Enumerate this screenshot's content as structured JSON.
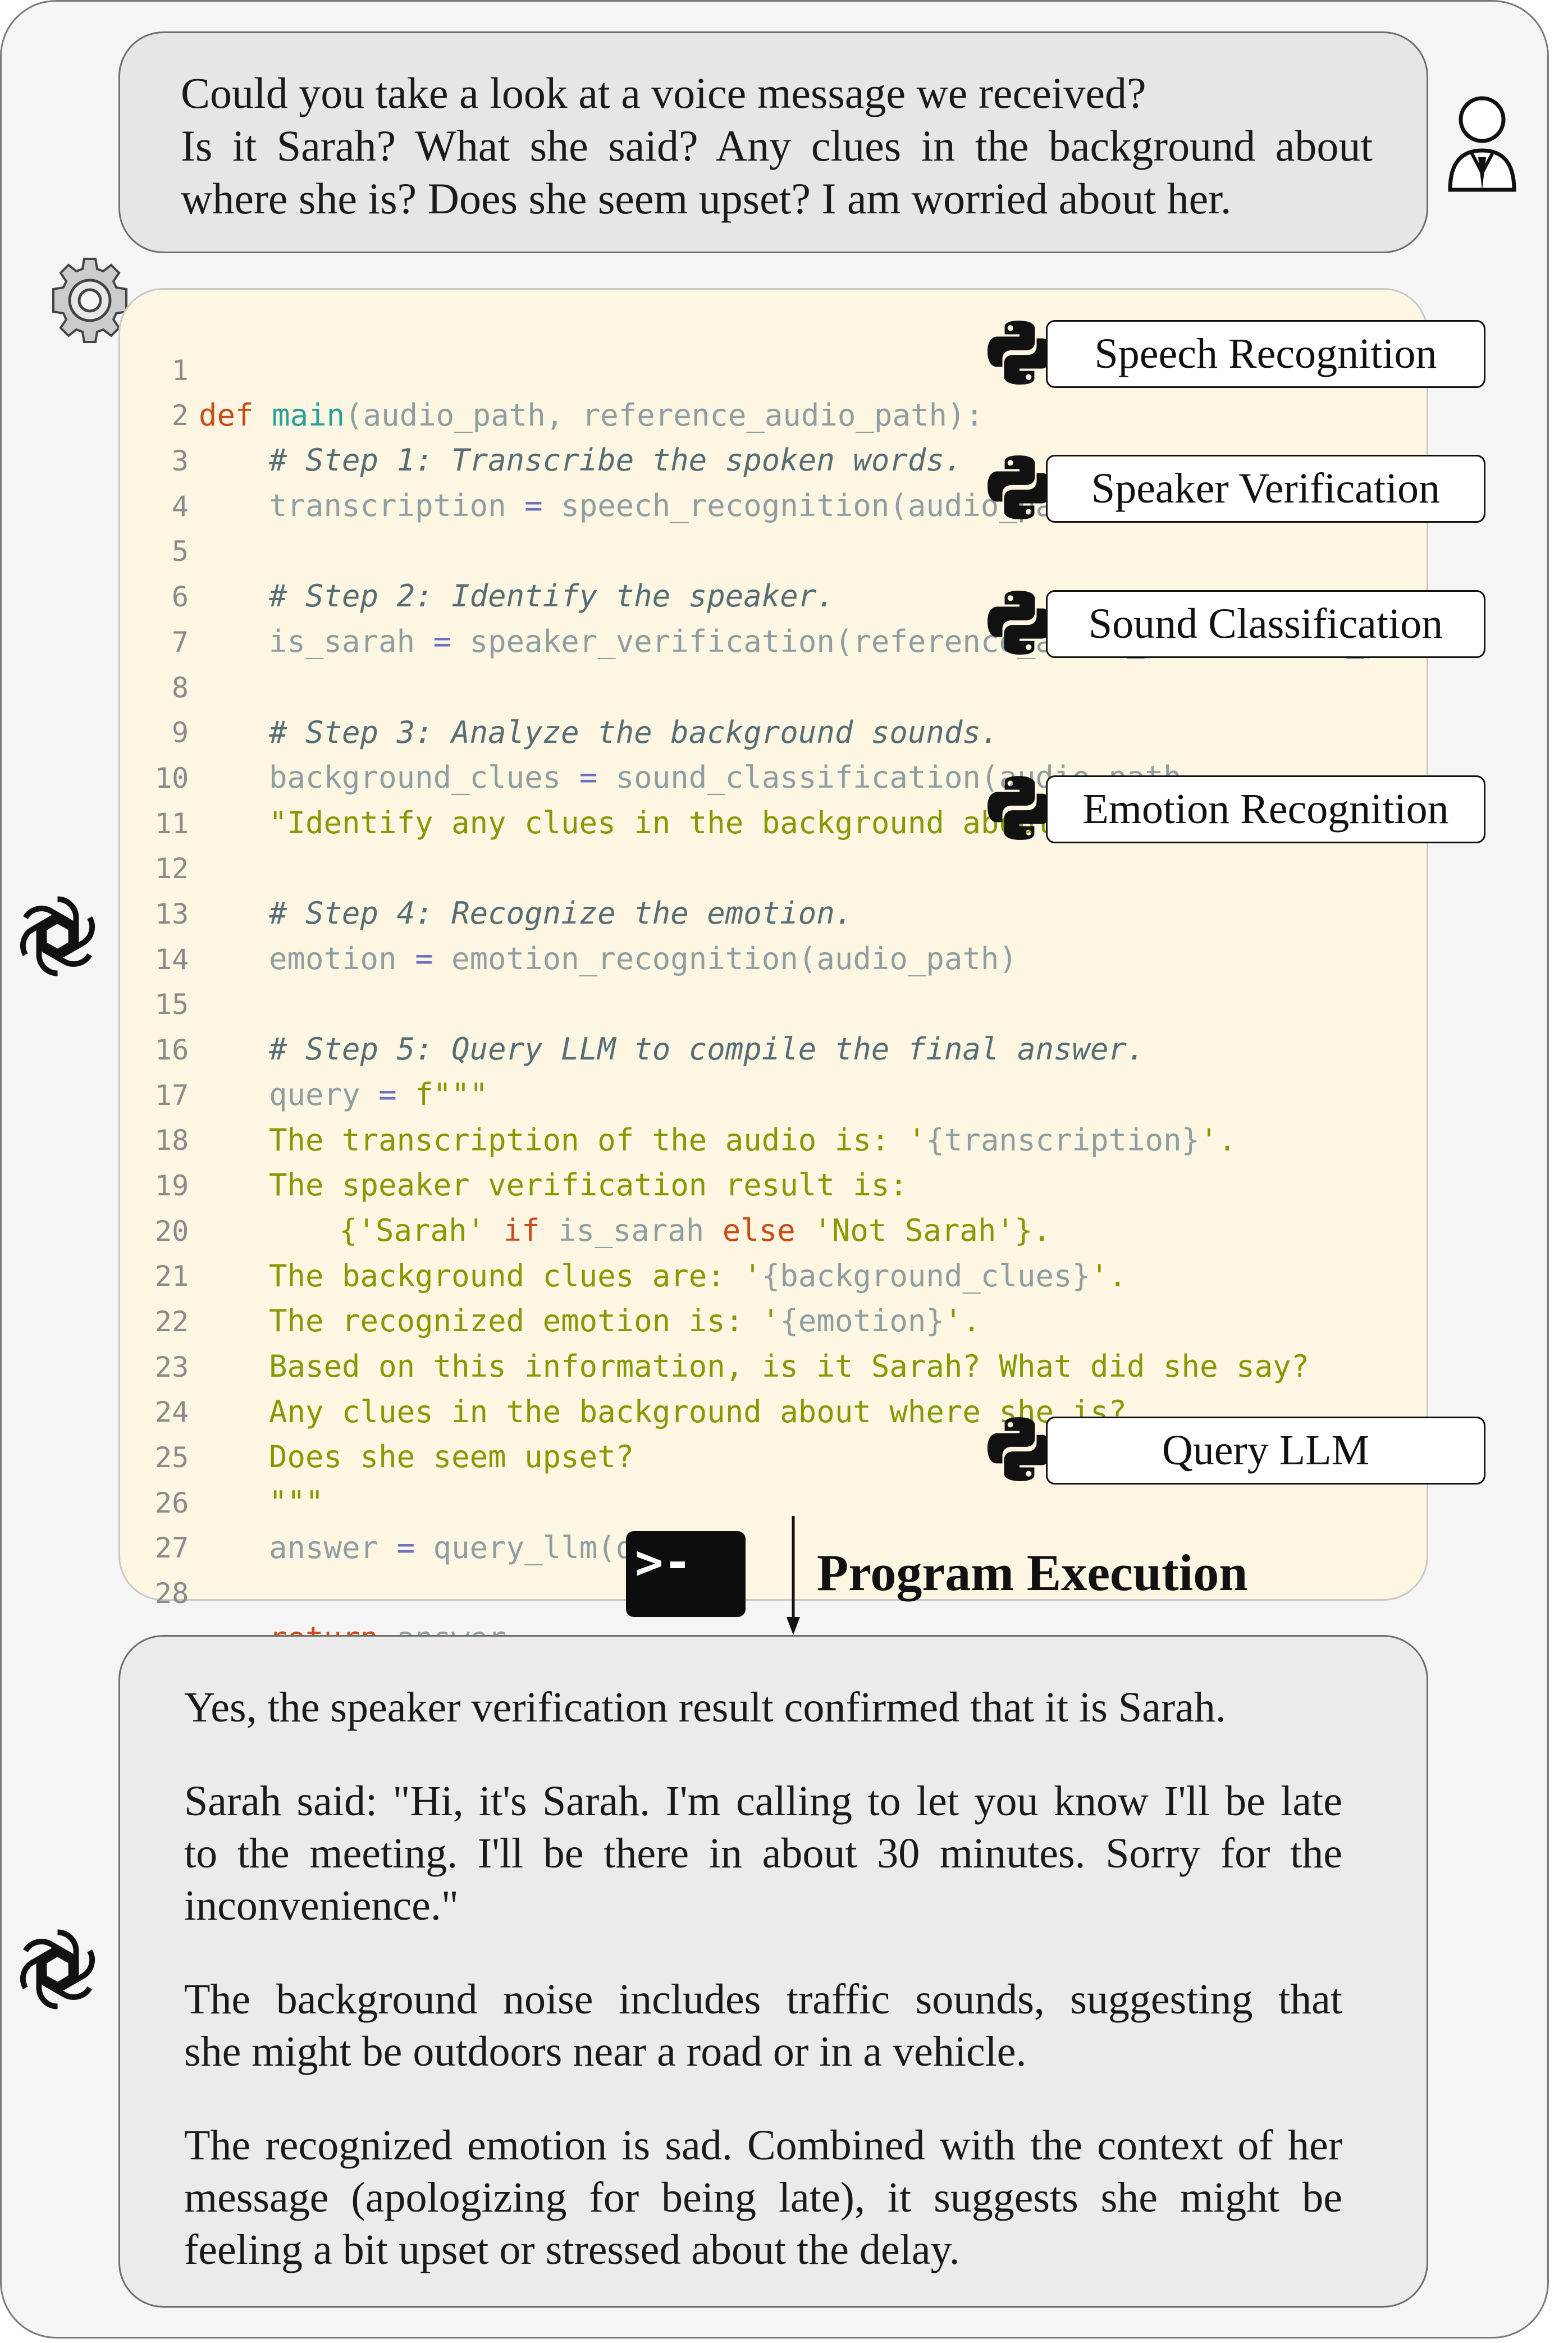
{
  "user_query": {
    "lines": [
      "Could you take a look at a voice message we received?",
      "Is it Sarah? What she said? Any clues in the background about",
      "where she is? Does she seem upset? I am worried about her."
    ]
  },
  "code": {
    "line_numbers": [
      "1",
      "2",
      "3",
      "4",
      "5",
      "6",
      "7",
      "8",
      "9",
      "10",
      "11",
      "12",
      "13",
      "14",
      "15",
      "16",
      "17",
      "18",
      "19",
      "20",
      "21",
      "22",
      "23",
      "24",
      "25",
      "26",
      "27",
      "28"
    ],
    "l1_def": "def",
    "l1_fn": "main",
    "l1_rest": "(audio_path, reference_audio_path):",
    "l2": "# Step 1: Transcribe the spoken words.",
    "l3_var": "transcription",
    "l3_op": "=",
    "l3_call": "speech_recognition(audio_path)",
    "l5": "# Step 2: Identify the speaker.",
    "l6_var": "is_sarah",
    "l6_op": "=",
    "l6_call": "speaker_verification(reference_audio_path, audio_path)",
    "l8": "# Step 3: Analyze the background sounds.",
    "l9_var": "background_clues",
    "l9_op": "=",
    "l9_call": "sound_classification(audio_path,",
    "l10": "\"Identify any clues in the background about the location.\"",
    "l10_end": ")",
    "l12": "# Step 4: Recognize the emotion.",
    "l13_var": "emotion",
    "l13_op": "=",
    "l13_call": "emotion_recognition(audio_path)",
    "l15": "# Step 5: Query LLM to compile the final answer.",
    "l16_var": "query",
    "l16_op": "=",
    "l16_str": "f\"\"\"",
    "l17_a": "The transcription of the audio is: '",
    "l17_b": "{transcription}",
    "l17_c": "'.",
    "l18": "The speaker verification result is:",
    "l19_a": "{",
    "l19_b": "'Sarah'",
    "l19_c": "if",
    "l19_d": "is_sarah",
    "l19_e": "else",
    "l19_f": "'Not Sarah'",
    "l19_g": "}.",
    "l20_a": "The background clues are: '",
    "l20_b": "{background_clues}",
    "l20_c": "'.",
    "l21_a": "The recognized emotion is: '",
    "l21_b": "{emotion}",
    "l21_c": "'.",
    "l22": "Based on this information, is it Sarah? What did she say?",
    "l23": "Any clues in the background about where she is?",
    "l24": "Does she seem upset?",
    "l25": "\"\"\"",
    "l26_var": "answer",
    "l26_op": "=",
    "l26_call": "query_llm(query)",
    "l28_kw": "return",
    "l28_var": "answer"
  },
  "tools": {
    "speech": "Speech Recognition",
    "speaker": "Speaker Verification",
    "sound": "Sound Classification",
    "emotion": "Emotion Recognition",
    "llm": "Query LLM"
  },
  "execution": {
    "label": "Program Execution",
    "prompt": ">-"
  },
  "answer": {
    "p1": "Yes, the speaker verification result confirmed that it is Sarah.",
    "p2_lines": [
      "Sarah said: \"Hi, it's Sarah. I'm calling to let you know I'll be late",
      "to the meeting. I'll be there in about 30 minutes. Sorry for the",
      "inconvenience.\""
    ],
    "p3_lines": [
      "The background noise includes traffic sounds, suggesting that",
      "she might be outdoors near a road or in a vehicle."
    ],
    "p4_lines": [
      "The recognized emotion is sad. Combined with the context of her",
      "message (apologizing for being late), it suggests she might be",
      "feeling a bit upset or stressed about the delay."
    ]
  },
  "icons": {
    "user": "user-avatar-icon",
    "gear": "gear-icon",
    "openai": "openai-logo-icon",
    "python": "python-logo-icon",
    "terminal": "terminal-icon"
  }
}
